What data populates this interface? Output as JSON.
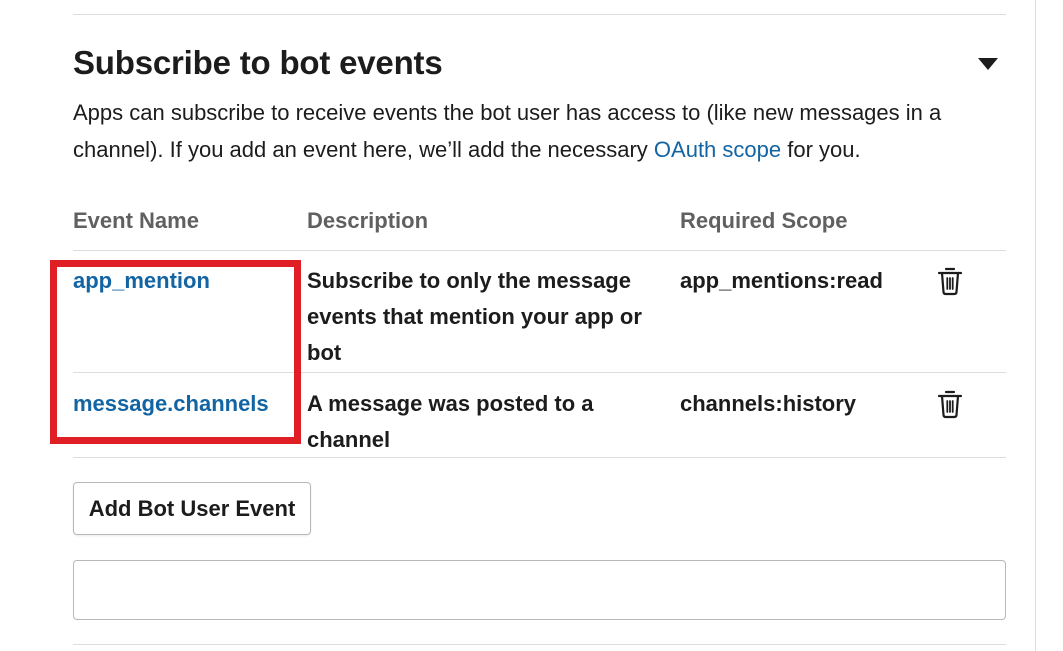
{
  "section": {
    "title": "Subscribe to bot events",
    "collapse_icon": "caret-down-icon",
    "intro_before_link": "Apps can subscribe to receive events the bot user has access to (like new messages in a channel). If you add an event here, we’ll add the necessary ",
    "intro_link": "OAuth scope",
    "intro_after_link": " for you."
  },
  "table": {
    "columns": [
      "Event Name",
      "Description",
      "Required Scope"
    ],
    "rows": [
      {
        "event": "app_mention",
        "description": "Subscribe to only the message events that mention your app or bot",
        "scope": "app_mentions:read",
        "delete_icon": "trash-icon"
      },
      {
        "event": "message.channels",
        "description": "A message was posted to a channel",
        "scope": "channels:history",
        "delete_icon": "trash-icon"
      }
    ]
  },
  "actions": {
    "add_label": "Add Bot User Event"
  },
  "search": {
    "value": "",
    "placeholder": ""
  },
  "colors": {
    "link": "#1264a3",
    "highlight": "#e01e26",
    "border": "#dddddd",
    "header_text": "#616061"
  }
}
